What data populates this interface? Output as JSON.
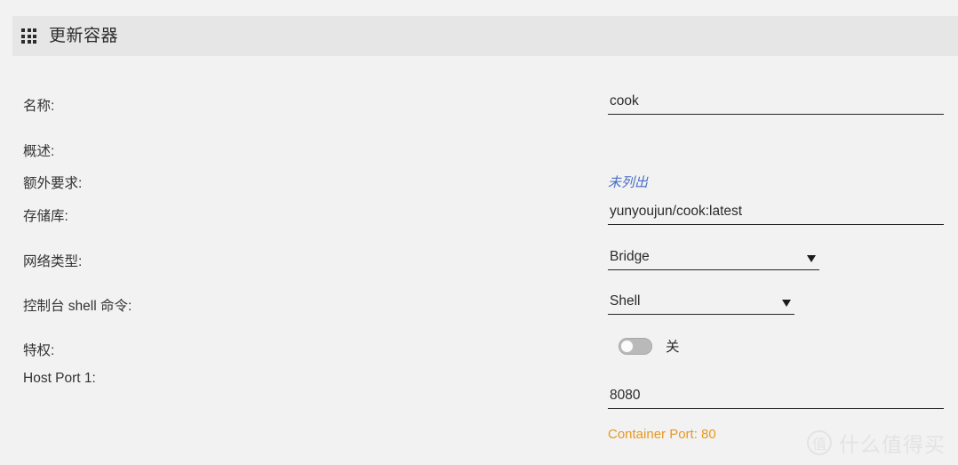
{
  "header": {
    "icon": "grid-3x3-icon",
    "title": "更新容器"
  },
  "form": {
    "fields": [
      {
        "label": "名称:",
        "type": "text",
        "value": "cook",
        "placeholder": ""
      },
      {
        "label": "概述:",
        "type": "empty",
        "value": ""
      },
      {
        "label": "额外要求:",
        "type": "link",
        "value": "未列出"
      },
      {
        "label": "存储库:",
        "type": "text",
        "value": "yunyoujun/cook:latest",
        "placeholder": ""
      },
      {
        "label": "网络类型:",
        "type": "select",
        "value": "Bridge"
      },
      {
        "label": "控制台 shell 命令:",
        "type": "select",
        "value": "Shell"
      },
      {
        "label": "特权:",
        "type": "toggle",
        "value": "关",
        "state": "off"
      },
      {
        "label": "Host Port 1:",
        "type": "text",
        "value": "8080",
        "placeholder": "",
        "hint": "Container Port: 80"
      }
    ]
  },
  "watermark": {
    "logo": "值",
    "text": "什么值得买"
  },
  "colors": {
    "page_background": "#f2f2f2",
    "header_background": "#e6e6e6",
    "text": "#2b2b2b",
    "link": "#4a6fc3",
    "hint": "#e8981e",
    "underline": "#262626",
    "toggle_track": "#b9b9b9",
    "watermark": "#e3e3e3"
  }
}
